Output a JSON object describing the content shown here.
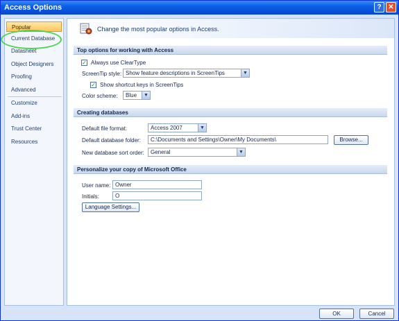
{
  "window": {
    "title": "Access Options",
    "help_glyph": "?",
    "close_glyph": "✕"
  },
  "sidebar": {
    "items": [
      {
        "label": "Popular"
      },
      {
        "label": "Current Database"
      },
      {
        "label": "Datasheet"
      },
      {
        "label": "Object Designers"
      },
      {
        "label": "Proofing"
      },
      {
        "label": "Advanced"
      },
      {
        "label": "Customize"
      },
      {
        "label": "Add-ins"
      },
      {
        "label": "Trust Center"
      },
      {
        "label": "Resources"
      }
    ],
    "selected": "Popular"
  },
  "header": {
    "text": "Change the most popular options in Access."
  },
  "sections": {
    "top": {
      "title": "Top options for working with Access",
      "cleartype_label": "Always use ClearType",
      "cleartype_checked": "✓",
      "screentip_label": "ScreenTip style:",
      "screentip_value": "Show feature descriptions in ScreenTips",
      "shortcut_label": "Show shortcut keys in ScreenTips",
      "shortcut_checked": "✓",
      "color_label": "Color scheme:",
      "color_value": "Blue"
    },
    "creating": {
      "title": "Creating databases",
      "format_label": "Default file format:",
      "format_value": "Access 2007",
      "folder_label": "Default database folder:",
      "folder_value": "C:\\Documents and Settings\\Owner\\My Documents\\",
      "browse_label": "Browse...",
      "sort_label": "New database sort order:",
      "sort_value": "General"
    },
    "personalize": {
      "title": "Personalize your copy of Microsoft Office",
      "user_label": "User name:",
      "user_value": "Owner",
      "initials_label": "Initials:",
      "initials_value": "O",
      "language_label": "Language Settings..."
    }
  },
  "footer": {
    "ok_label": "OK",
    "cancel_label": "Cancel"
  },
  "colors": {
    "title_bar": "#0a5ee6",
    "annotation_circle": "#48d64a",
    "selected_item": "#ffc45a"
  }
}
